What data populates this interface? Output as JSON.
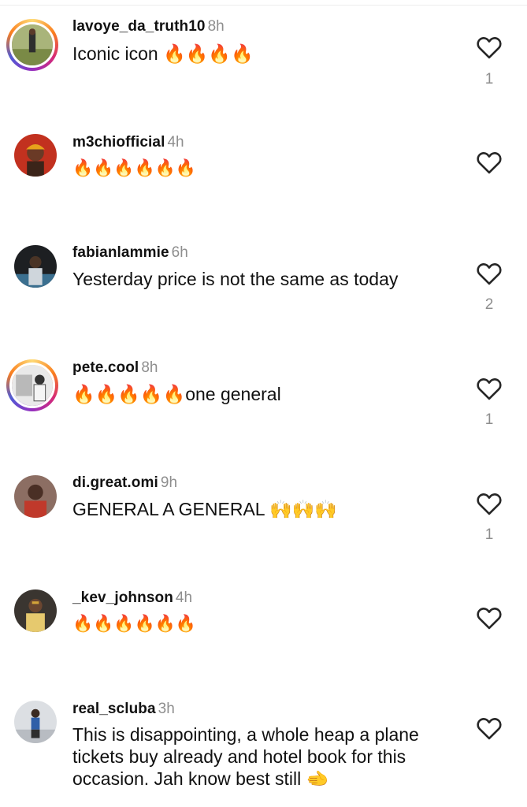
{
  "comments": [
    {
      "username": "lavoye_da_truth10",
      "time": "8h",
      "text": "Iconic icon 🔥🔥🔥🔥",
      "likes": "1"
    },
    {
      "username": "m3chiofficial",
      "time": "4h",
      "text": "🔥🔥🔥🔥🔥🔥",
      "likes": ""
    },
    {
      "username": "fabianlammie",
      "time": "6h",
      "text": "Yesterday price is not the same as today",
      "likes": "2"
    },
    {
      "username": "pete.cool",
      "time": "8h",
      "text": "🔥🔥🔥🔥🔥one general",
      "likes": "1"
    },
    {
      "username": "di.great.omi",
      "time": "9h",
      "text": "GENERAL A GENERAL 🙌🙌🙌",
      "likes": "1"
    },
    {
      "username": "_kev_johnson",
      "time": "4h",
      "text": "🔥🔥🔥🔥🔥🔥",
      "likes": ""
    },
    {
      "username": "real_scluba",
      "time": "3h",
      "text": "This is disappointing, a whole heap a plane tickets buy already and hotel book for this occasion. Jah know best still 🫲",
      "likes": ""
    }
  ],
  "icons": {
    "like": "heart-outline-icon"
  },
  "colors": {
    "story_ring": "#d62976",
    "secondary_text": "#8e8e8e"
  }
}
